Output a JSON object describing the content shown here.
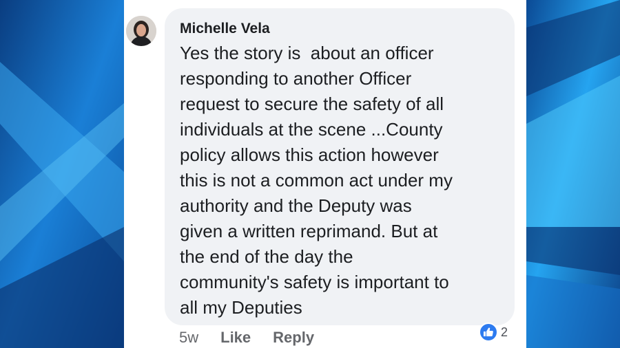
{
  "comment": {
    "author": "Michelle Vela",
    "lines": [
      "Yes the story is  about an officer",
      "responding to another Officer",
      "request to secure the safety of all",
      "individuals at the scene ...County",
      "policy allows this action however",
      "this is not a common act under my",
      "authority and the Deputy was",
      "given a written reprimand. But at",
      "the end of the day the",
      "community's safety is important to",
      "all my Deputies"
    ],
    "time": "5w",
    "like_label": "Like",
    "reply_label": "Reply",
    "reaction_count": "2",
    "reaction_icon": "thumbs-up-icon"
  },
  "colors": {
    "bubble": "#f0f2f5",
    "reaction_blue": "#2d7bf0",
    "background_blue": "#0b5fb0"
  }
}
